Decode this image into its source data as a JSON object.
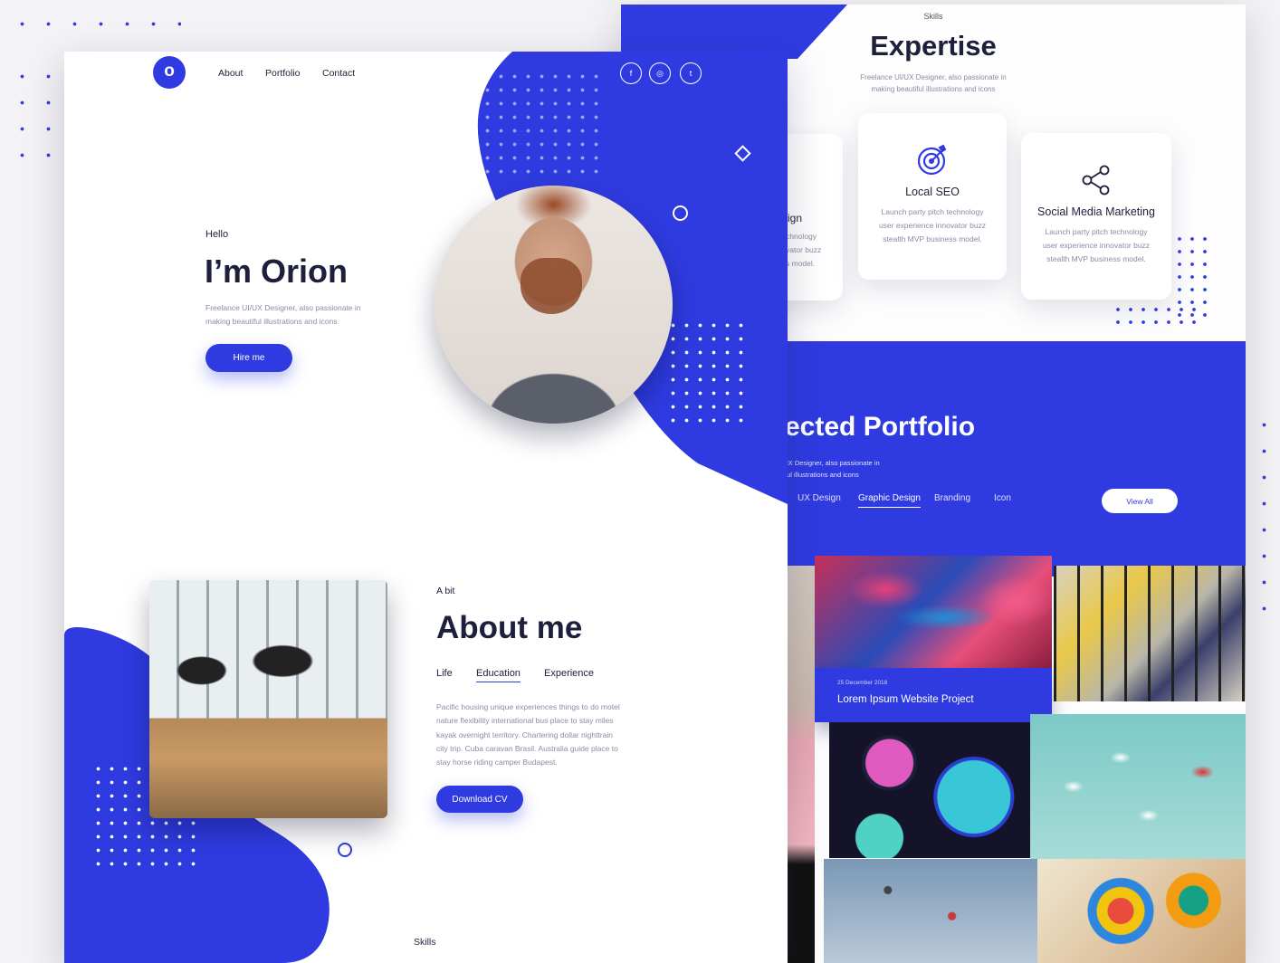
{
  "colors": {
    "accent": "#2f3be0",
    "dark": "#1d1f3b",
    "muted": "#8a8ca3"
  },
  "nav": {
    "logo_letter": "o",
    "items": [
      "About",
      "Portfolio",
      "Contact"
    ],
    "social": [
      "f",
      "◎",
      "t"
    ]
  },
  "hero": {
    "greeting": "Hello",
    "name": "I’m Orion",
    "desc": [
      "Freelance UI/UX Designer, also passionate in",
      "making beautiful illustrations and icons"
    ],
    "cta": "Hire me"
  },
  "about": {
    "kicker": "A bit",
    "title": "About me",
    "tabs": [
      "Life",
      "Education",
      "Experience"
    ],
    "active_tab": "Education",
    "text": [
      "Pacific housing unique experiences things to do motel",
      "nature flexibility international bus place to stay miles",
      "kayak overnight territory. Chartering dollar nighttrain",
      "city trip. Cuba caravan Brasil. Australia guide place to",
      "stay horse riding camper Budapest."
    ],
    "cta": "Download CV"
  },
  "skills_footer": "Skills",
  "expertise": {
    "kicker": "Skills",
    "title": "Expertise",
    "desc": [
      "Freelance UI/UX Designer, also passionate in",
      "making beautiful illustrations and icons"
    ],
    "cards": [
      {
        "title": "ign",
        "text": [
          "chnology",
          "vator buzz",
          "s model."
        ],
        "icon": ""
      },
      {
        "title": "Local SEO",
        "text": [
          "Launch party pitch technology",
          "user experience innovator buzz",
          "stealth MVP business model."
        ],
        "icon": "target-icon"
      },
      {
        "title": "Social Media Marketing",
        "text": [
          "Launch party pitch technology",
          "user experience innovator buzz",
          "stealth MVP business model."
        ],
        "icon": "share-icon"
      }
    ]
  },
  "portfolio": {
    "title": "ected Portfolio",
    "desc": [
      "JX Designer, also passionate in",
      "ful illustrations and icons"
    ],
    "tabs": [
      "UX Design",
      "Graphic Design",
      "Branding",
      "Icon"
    ],
    "active_tab": "Graphic Design",
    "view_all": "View All",
    "featured": {
      "date": "25 December 2018",
      "title": "Lorem Ipsum Website Project"
    }
  }
}
